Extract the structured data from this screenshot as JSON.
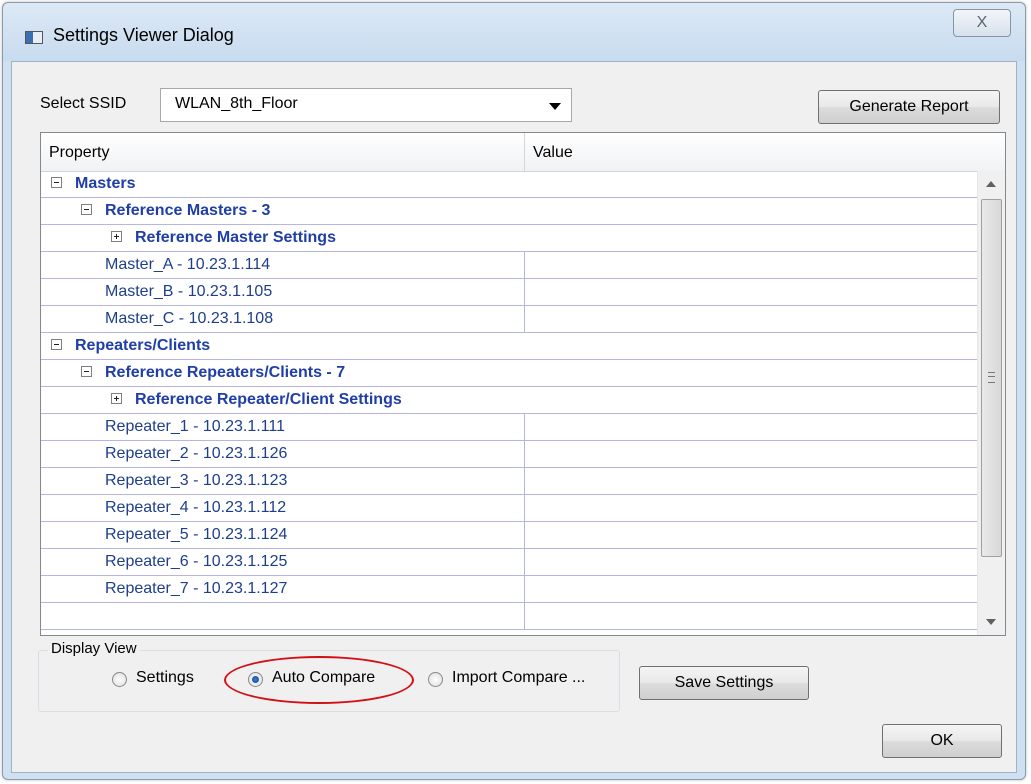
{
  "window": {
    "title": "Settings Viewer Dialog",
    "close_glyph": "X",
    "icon": "app-window-icon"
  },
  "ssid": {
    "label": "Select SSID",
    "selected": "WLAN_8th_Floor"
  },
  "buttons": {
    "generate_report": "Generate Report",
    "save_settings": "Save Settings",
    "ok": "OK"
  },
  "tree": {
    "columns": [
      "Property",
      "Value"
    ],
    "rows": [
      {
        "label": "Masters",
        "value": "",
        "level": 0,
        "toggle": "minus",
        "group": true
      },
      {
        "label": "Reference Masters - 3",
        "value": "",
        "level": 1,
        "toggle": "minus",
        "group": true
      },
      {
        "label": "Reference Master Settings",
        "value": "",
        "level": 2,
        "toggle": "plus",
        "group": true
      },
      {
        "label": "Master_A - 10.23.1.114",
        "value": "",
        "level": 3,
        "toggle": "",
        "group": false
      },
      {
        "label": "Master_B - 10.23.1.105",
        "value": "",
        "level": 3,
        "toggle": "",
        "group": false
      },
      {
        "label": "Master_C - 10.23.1.108",
        "value": "",
        "level": 3,
        "toggle": "",
        "group": false
      },
      {
        "label": "Repeaters/Clients",
        "value": "",
        "level": 0,
        "toggle": "minus",
        "group": true
      },
      {
        "label": "Reference Repeaters/Clients - 7",
        "value": "",
        "level": 1,
        "toggle": "minus",
        "group": true
      },
      {
        "label": "Reference Repeater/Client Settings",
        "value": "",
        "level": 2,
        "toggle": "plus",
        "group": true
      },
      {
        "label": "Repeater_1 - 10.23.1.111",
        "value": "",
        "level": 3,
        "toggle": "",
        "group": false
      },
      {
        "label": "Repeater_2 - 10.23.1.126",
        "value": "",
        "level": 3,
        "toggle": "",
        "group": false
      },
      {
        "label": "Repeater_3 - 10.23.1.123",
        "value": "",
        "level": 3,
        "toggle": "",
        "group": false
      },
      {
        "label": "Repeater_4 - 10.23.1.112",
        "value": "",
        "level": 3,
        "toggle": "",
        "group": false
      },
      {
        "label": "Repeater_5 - 10.23.1.124",
        "value": "",
        "level": 3,
        "toggle": "",
        "group": false
      },
      {
        "label": "Repeater_6 - 10.23.1.125",
        "value": "",
        "level": 3,
        "toggle": "",
        "group": false
      },
      {
        "label": "Repeater_7 - 10.23.1.127",
        "value": "",
        "level": 3,
        "toggle": "",
        "group": false
      },
      {
        "label": "",
        "value": "",
        "level": 3,
        "toggle": "",
        "group": false
      }
    ]
  },
  "display_view": {
    "legend": "Display View",
    "options": [
      {
        "label": "Settings",
        "checked": false
      },
      {
        "label": "Auto Compare",
        "checked": true
      },
      {
        "label": "Import Compare ...",
        "checked": false
      }
    ],
    "annotation_color": "#d20f16"
  },
  "colors": {
    "group_text": "#1f3ea7",
    "item_text": "#1d3e8c",
    "row_border": "#b7b5e3"
  }
}
